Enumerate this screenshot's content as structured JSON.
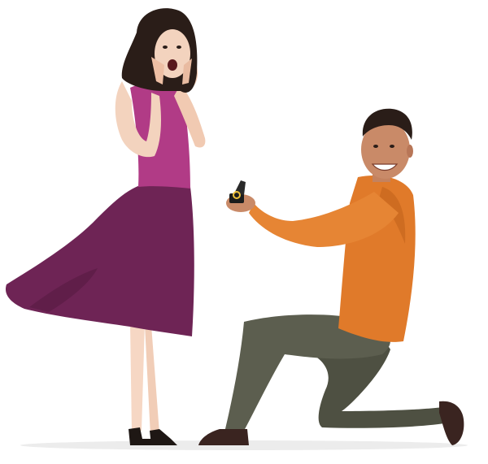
{
  "scene": {
    "subject": "proposal-illustration",
    "palette": {
      "background": "#ffffff",
      "dress_skirt": "#6e2455",
      "dress_top": "#b13b86",
      "skin_light": "#f3d3be",
      "skin_tan": "#c98a68",
      "sweater": "#e07a2a",
      "pants": "#56584a",
      "shoes": "#3a2420",
      "hair_dark": "#2a1d18",
      "ring_gold": "#f0c23a",
      "ground_shadow": "#ececec"
    }
  }
}
